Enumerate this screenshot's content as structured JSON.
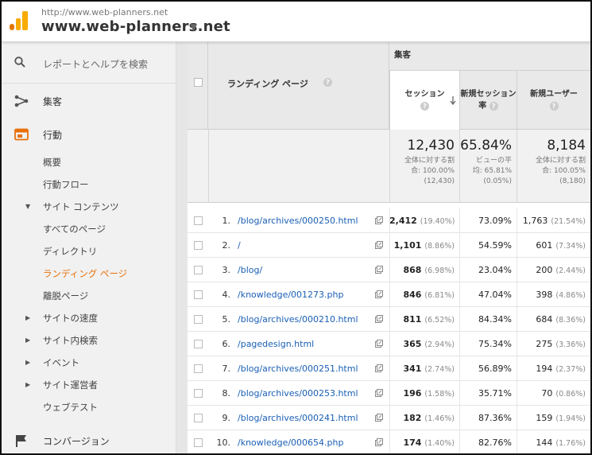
{
  "header": {
    "site_url": "http://www.web-planners.net",
    "site_name": "www.web-planners.net"
  },
  "sidebar": {
    "search_label": "レポートとヘルプを検索",
    "acquisition": "集客",
    "behavior": "行動",
    "items": {
      "overview": "概要",
      "behavior_flow": "行動フロー",
      "site_content": "サイト コンテンツ",
      "all_pages": "すべてのページ",
      "directory": "ディレクトリ",
      "landing_pages": "ランディング ページ",
      "exit_pages": "離脱ページ",
      "site_speed": "サイトの速度",
      "site_search": "サイト内検索",
      "events": "イベント",
      "publisher": "サイト運営者",
      "web_test": "ウェブテスト"
    },
    "conversions": "コンバージョン"
  },
  "table": {
    "landing_header": "ランディング ページ",
    "group_header": "集客",
    "col_sessions": "セッション",
    "col_new_sessions_1": "新規セッション",
    "col_new_sessions_2": "率",
    "col_new_users": "新規ユーザー",
    "summary": {
      "sessions_value": "12,430",
      "sessions_l1": "全体に対する割",
      "sessions_l2": "合: 100.00%",
      "sessions_l3": "(12,430)",
      "rate_value": "65.84%",
      "rate_l1": "ビューの平",
      "rate_l2": "均: 65.81%",
      "rate_l3": "(0.05%)",
      "users_value": "8,184",
      "users_l1": "全体に対する割",
      "users_l2": "合: 100.05%",
      "users_l3": "(8,180)"
    },
    "rows": [
      {
        "n": "1.",
        "page": "/blog/archives/000250.html",
        "sessions": "2,412",
        "spct": "(19.40%)",
        "rate": "73.09%",
        "users": "1,763",
        "upct": "(21.54%)"
      },
      {
        "n": "2.",
        "page": "/",
        "sessions": "1,101",
        "spct": "(8.86%)",
        "rate": "54.59%",
        "users": "601",
        "upct": "(7.34%)"
      },
      {
        "n": "3.",
        "page": "/blog/",
        "sessions": "868",
        "spct": "(6.98%)",
        "rate": "23.04%",
        "users": "200",
        "upct": "(2.44%)"
      },
      {
        "n": "4.",
        "page": "/knowledge/001273.php",
        "sessions": "846",
        "spct": "(6.81%)",
        "rate": "47.04%",
        "users": "398",
        "upct": "(4.86%)"
      },
      {
        "n": "5.",
        "page": "/blog/archives/000210.html",
        "sessions": "811",
        "spct": "(6.52%)",
        "rate": "84.34%",
        "users": "684",
        "upct": "(8.36%)"
      },
      {
        "n": "6.",
        "page": "/pagedesign.html",
        "sessions": "365",
        "spct": "(2.94%)",
        "rate": "75.34%",
        "users": "275",
        "upct": "(3.36%)"
      },
      {
        "n": "7.",
        "page": "/blog/archives/000251.html",
        "sessions": "341",
        "spct": "(2.74%)",
        "rate": "56.89%",
        "users": "194",
        "upct": "(2.37%)"
      },
      {
        "n": "8.",
        "page": "/blog/archives/000253.html",
        "sessions": "196",
        "spct": "(1.58%)",
        "rate": "35.71%",
        "users": "70",
        "upct": "(0.86%)"
      },
      {
        "n": "9.",
        "page": "/blog/archives/000241.html",
        "sessions": "182",
        "spct": "(1.46%)",
        "rate": "87.36%",
        "users": "159",
        "upct": "(1.94%)"
      },
      {
        "n": "10.",
        "page": "/knowledge/000654.php",
        "sessions": "174",
        "spct": "(1.40%)",
        "rate": "82.76%",
        "users": "144",
        "upct": "(1.76%)"
      }
    ]
  }
}
